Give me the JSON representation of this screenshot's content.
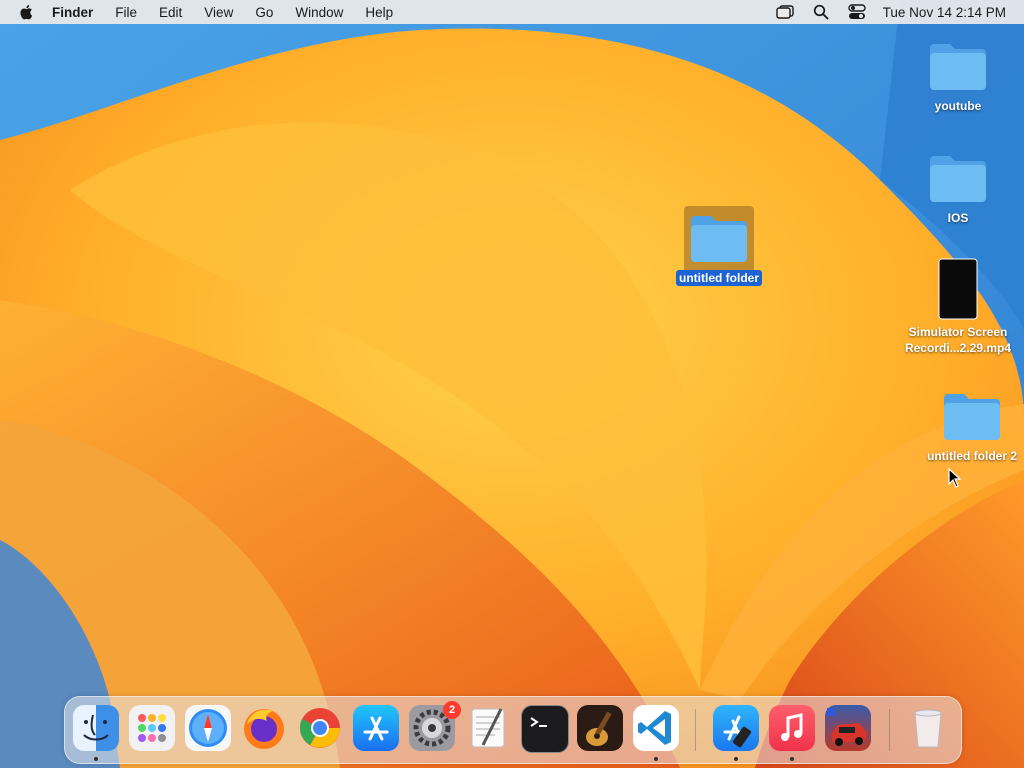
{
  "menubar": {
    "app_name": "Finder",
    "menus": [
      "File",
      "Edit",
      "View",
      "Go",
      "Window",
      "Help"
    ],
    "clock": "Tue Nov 14  2:14 PM"
  },
  "desktop": {
    "items": [
      {
        "label": "youtube",
        "kind": "folder"
      },
      {
        "label": "IOS",
        "kind": "folder"
      },
      {
        "label_line1": "Simulator Screen",
        "label_line2": "Recordi...2.29.mp4",
        "kind": "video"
      },
      {
        "label": "untitled folder 2",
        "kind": "folder"
      },
      {
        "label": "untitled folder",
        "kind": "folder",
        "selected": true
      }
    ]
  },
  "dock": {
    "apps": [
      {
        "name": "Finder",
        "icon": "finder-icon",
        "running": true
      },
      {
        "name": "Launchpad",
        "icon": "launchpad-icon"
      },
      {
        "name": "Safari",
        "icon": "safari-icon"
      },
      {
        "name": "Firefox",
        "icon": "firefox-icon"
      },
      {
        "name": "Chrome",
        "icon": "chrome-icon"
      },
      {
        "name": "App Store",
        "icon": "app-store-icon"
      },
      {
        "name": "System Settings",
        "icon": "system-settings-icon",
        "badge": "2"
      },
      {
        "name": "TextEdit",
        "icon": "textedit-icon"
      },
      {
        "name": "Terminal",
        "icon": "terminal-icon"
      },
      {
        "name": "GarageBand",
        "icon": "garageband-icon"
      },
      {
        "name": "Visual Studio Code",
        "icon": "vscode-icon",
        "running": true
      },
      {
        "name": "Xcode Simulator",
        "icon": "simulator-icon",
        "running": true
      },
      {
        "name": "Music",
        "icon": "music-icon",
        "running": true
      },
      {
        "name": "Racing Game",
        "icon": "game-icon"
      },
      {
        "name": "Trash",
        "icon": "trash-icon"
      }
    ],
    "system_settings_badge": "2"
  },
  "colors": {
    "selection": "#1e63d6",
    "folder": "#5ab0ee",
    "wallpaper_orange": "#ff8c1e"
  }
}
